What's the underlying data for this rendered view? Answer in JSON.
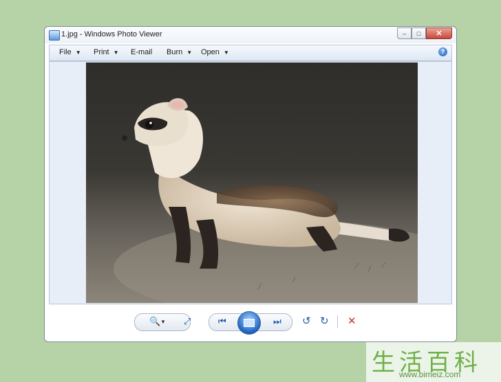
{
  "window": {
    "title": "1.jpg - Windows Photo Viewer",
    "buttons": {
      "minimize": "–",
      "maximize": "□",
      "close": "✕"
    }
  },
  "menubar": {
    "items": [
      {
        "label": "File",
        "has_dropdown": true
      },
      {
        "label": "Print",
        "has_dropdown": true
      },
      {
        "label": "E-mail",
        "has_dropdown": false
      },
      {
        "label": "Burn",
        "has_dropdown": true
      },
      {
        "label": "Open",
        "has_dropdown": true
      }
    ],
    "help_icon": "?"
  },
  "viewer": {
    "image_subject": "ferret"
  },
  "controls": {
    "zoom": "🔍",
    "fit": "⤢",
    "previous": "⏮",
    "next": "⏭",
    "rotate_left": "↺",
    "rotate_right": "↻",
    "delete": "✕"
  },
  "watermark": {
    "chars": "生活百科",
    "url": "www.bimeiz.com"
  },
  "colors": {
    "background": "#b5d3a7",
    "accent": "#1d5ea8",
    "delete": "#c8362a"
  }
}
